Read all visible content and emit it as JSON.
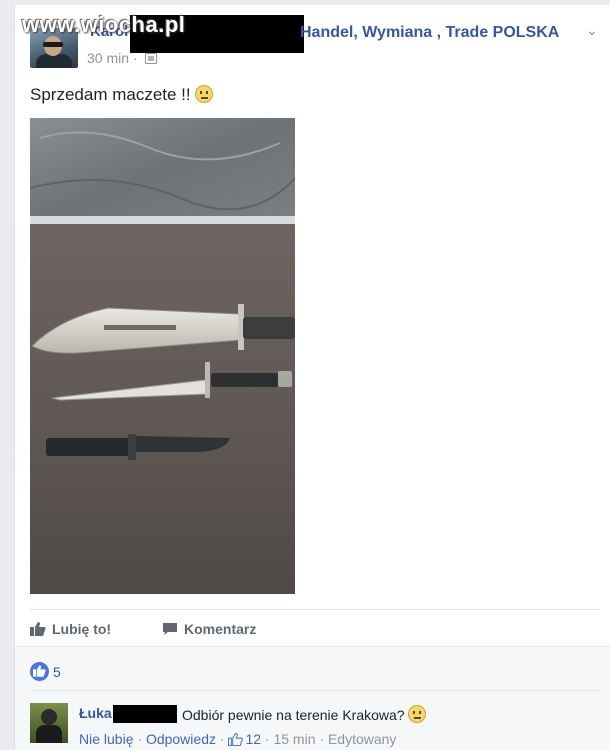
{
  "watermark": "www.wiocha.pl",
  "post": {
    "author_partial": "Karol",
    "group_name": "Handel, Wymiana , Trade POLSKA",
    "time": "30 min",
    "text": "Sprzedam maczete !!"
  },
  "actions": {
    "like_label": "Lubię to!",
    "comment_label": "Komentarz"
  },
  "reactions": {
    "count": "5"
  },
  "comment": {
    "author_partial": "Łuka",
    "text": "Odbiór pewnie na terenie Krakowa?",
    "unlike_label": "Nie lubię",
    "reply_label": "Odpowiedz",
    "likes": "12",
    "time": "15 min",
    "edited": "Edytowany",
    "separator": "·"
  },
  "colors": {
    "link_blue": "#365899",
    "like_blue": "#4a76d4",
    "muted_gray": "#90949c",
    "redaction": "#000000"
  }
}
